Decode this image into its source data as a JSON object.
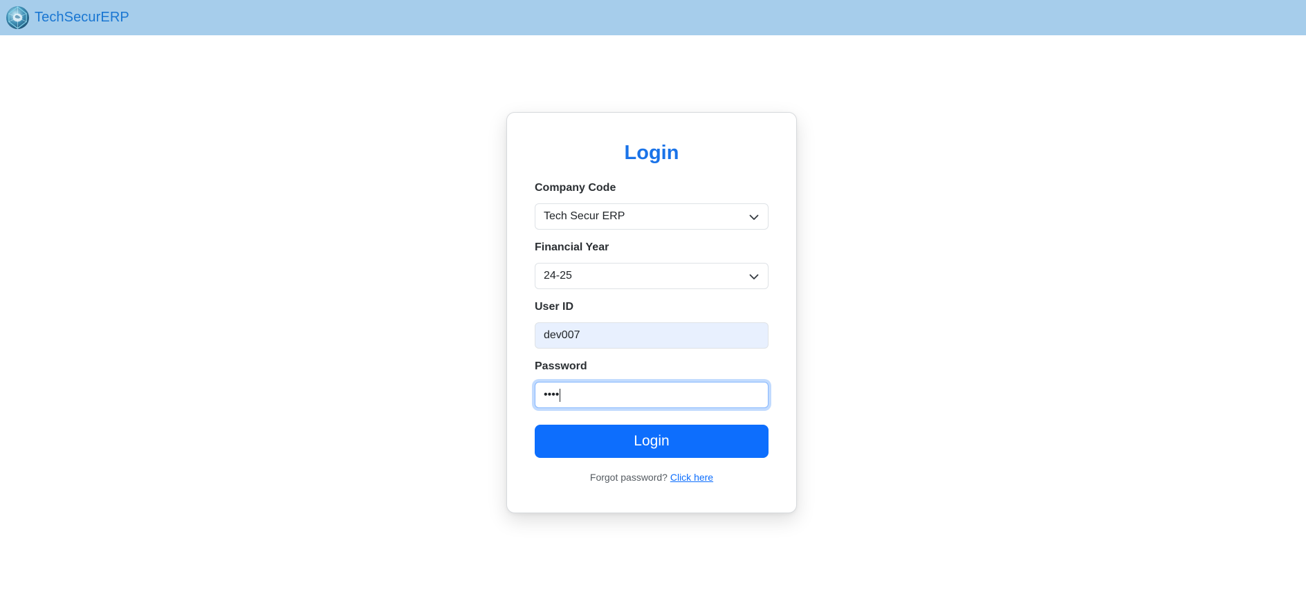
{
  "navbar": {
    "brand_text": "TechSecurERP",
    "logo_icon": "globe-logo-icon"
  },
  "login_card": {
    "title": "Login",
    "company_code": {
      "label": "Company Code",
      "value": "Tech Secur ERP"
    },
    "financial_year": {
      "label": "Financial Year",
      "value": "24-25"
    },
    "user_id": {
      "label": "User ID",
      "value": "dev007"
    },
    "password": {
      "label": "Password",
      "masked_value": "••••"
    },
    "submit_label": "Login",
    "forgot_text": "Forgot password?",
    "forgot_link": "Click here"
  },
  "colors": {
    "navbar_bg": "#a6cdeb",
    "accent": "#0d6efd",
    "title": "#1a73e8",
    "autofill_bg": "#e8f0fe"
  }
}
